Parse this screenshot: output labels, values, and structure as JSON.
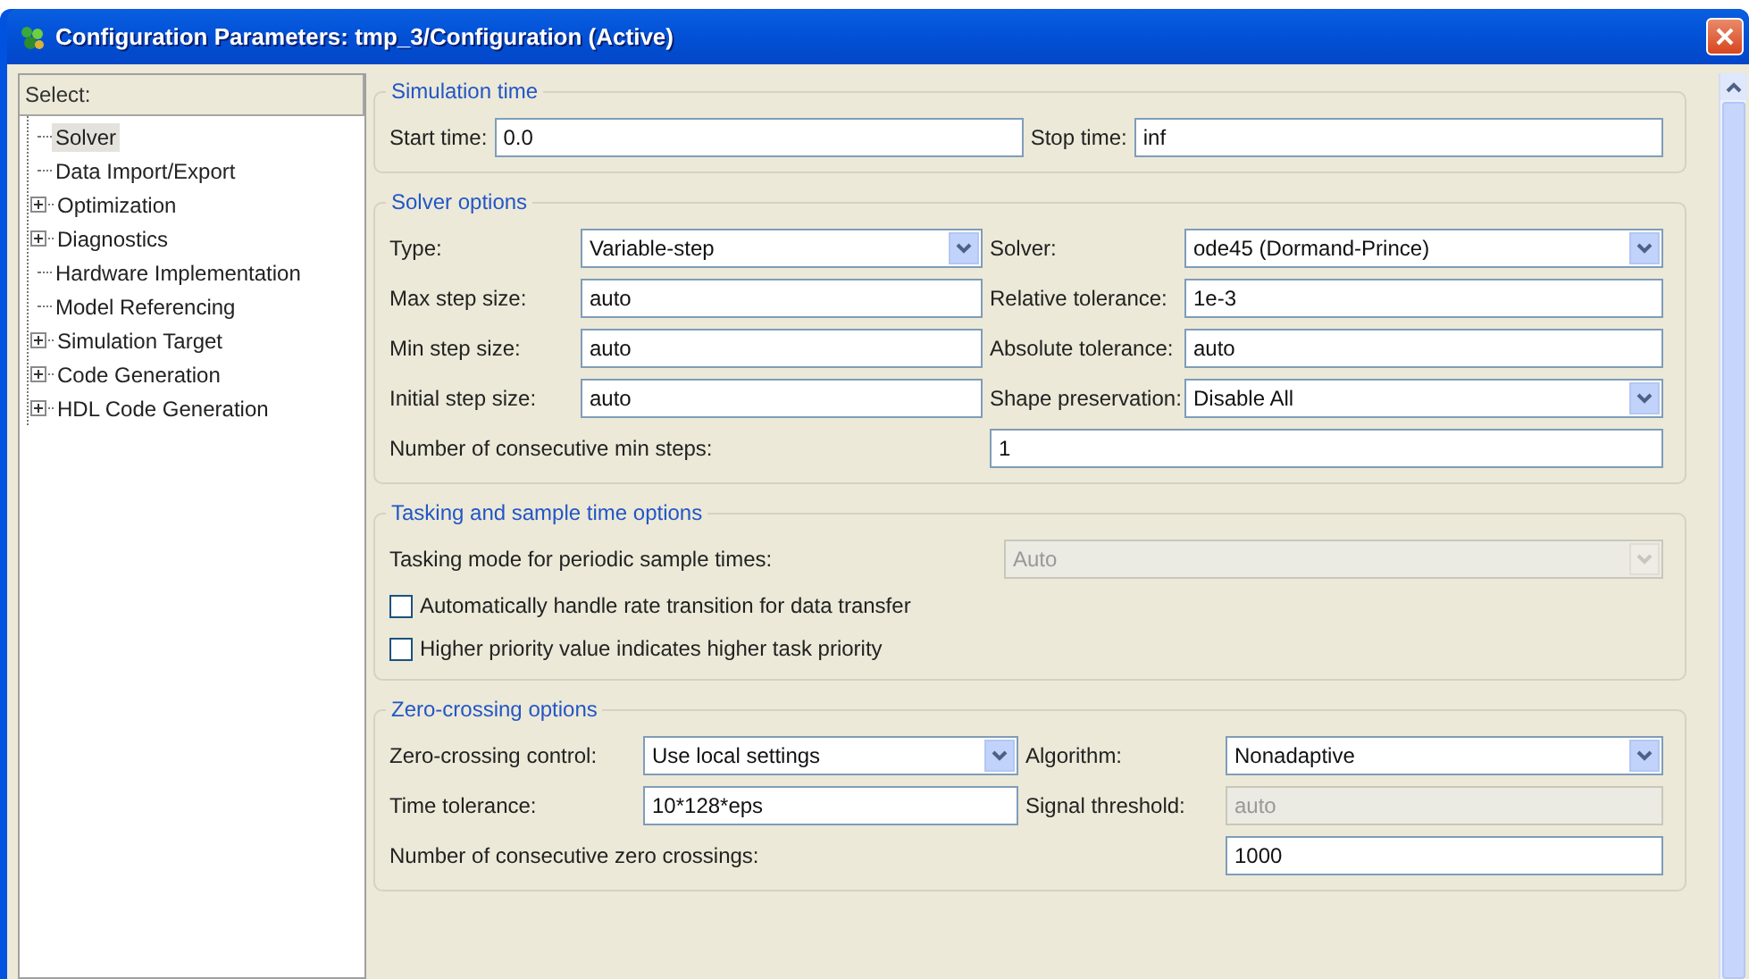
{
  "window": {
    "title": "Configuration Parameters: tmp_3/Configuration (Active)"
  },
  "tree": {
    "header": "Select:",
    "items": [
      {
        "label": "Solver",
        "expandable": false,
        "selected": true
      },
      {
        "label": "Data Import/Export",
        "expandable": false,
        "selected": false
      },
      {
        "label": "Optimization",
        "expandable": true,
        "selected": false
      },
      {
        "label": "Diagnostics",
        "expandable": true,
        "selected": false
      },
      {
        "label": "Hardware Implementation",
        "expandable": false,
        "selected": false
      },
      {
        "label": "Model Referencing",
        "expandable": false,
        "selected": false
      },
      {
        "label": "Simulation Target",
        "expandable": true,
        "selected": false
      },
      {
        "label": "Code Generation",
        "expandable": true,
        "selected": false
      },
      {
        "label": "HDL Code Generation",
        "expandable": true,
        "selected": false
      }
    ]
  },
  "sections": [
    {
      "title": "Simulation time",
      "rows": [
        [
          {
            "kind": "label",
            "text": "Start time:"
          },
          {
            "kind": "text",
            "value": "0.0",
            "disabled": false
          },
          {
            "kind": "label",
            "text": "Stop time:"
          },
          {
            "kind": "text",
            "value": "inf",
            "disabled": false
          }
        ]
      ]
    },
    {
      "title": "Solver options",
      "rows": [
        [
          {
            "kind": "label",
            "text": "Type:"
          },
          {
            "kind": "dropdown",
            "value": "Variable-step",
            "disabled": false
          },
          {
            "kind": "label",
            "text": "Solver:"
          },
          {
            "kind": "dropdown",
            "value": "ode45 (Dormand-Prince)",
            "disabled": false
          }
        ],
        [
          {
            "kind": "label",
            "text": "Max step size:"
          },
          {
            "kind": "text",
            "value": "auto",
            "disabled": false
          },
          {
            "kind": "label",
            "text": "Relative tolerance:"
          },
          {
            "kind": "text",
            "value": "1e-3",
            "disabled": false
          }
        ],
        [
          {
            "kind": "label",
            "text": "Min step size:"
          },
          {
            "kind": "text",
            "value": "auto",
            "disabled": false
          },
          {
            "kind": "label",
            "text": "Absolute tolerance:"
          },
          {
            "kind": "text",
            "value": "auto",
            "disabled": false
          }
        ],
        [
          {
            "kind": "label",
            "text": "Initial step size:"
          },
          {
            "kind": "text",
            "value": "auto",
            "disabled": false
          },
          {
            "kind": "label",
            "text": "Shape preservation:"
          },
          {
            "kind": "dropdown",
            "value": "Disable All",
            "disabled": false
          }
        ],
        [
          {
            "kind": "label",
            "text": "Number of consecutive min steps:"
          },
          "",
          {
            "kind": "text",
            "value": "1",
            "disabled": false
          }
        ]
      ]
    },
    {
      "title": "Tasking and sample time options",
      "rows": [
        [
          {
            "kind": "label",
            "text": "Tasking mode for periodic sample times:"
          },
          {
            "kind": "dropdown",
            "value": "Auto",
            "disabled": true
          }
        ],
        [
          {
            "kind": "checkbox",
            "label": "Automatically handle rate transition for data transfer",
            "checked": false
          }
        ],
        [
          {
            "kind": "checkbox",
            "label": "Higher priority value indicates higher task priority",
            "checked": false
          }
        ]
      ]
    },
    {
      "title": "Zero-crossing options",
      "rows": [
        [
          {
            "kind": "label",
            "text": "Zero-crossing control:"
          },
          {
            "kind": "dropdown",
            "value": "Use local settings",
            "disabled": false
          },
          {
            "kind": "label",
            "text": "Algorithm:"
          },
          {
            "kind": "dropdown",
            "value": "Nonadaptive",
            "disabled": false
          }
        ],
        [
          {
            "kind": "label",
            "text": "Time tolerance:"
          },
          {
            "kind": "text",
            "value": "10*128*eps",
            "disabled": false
          },
          {
            "kind": "label",
            "text": "Signal threshold:"
          },
          {
            "kind": "text",
            "value": "auto",
            "disabled": true
          }
        ],
        [
          {
            "kind": "label",
            "text": "Number of consecutive zero crossings:"
          },
          "",
          "",
          {
            "kind": "text",
            "value": "1000",
            "disabled": false
          }
        ]
      ]
    }
  ]
}
